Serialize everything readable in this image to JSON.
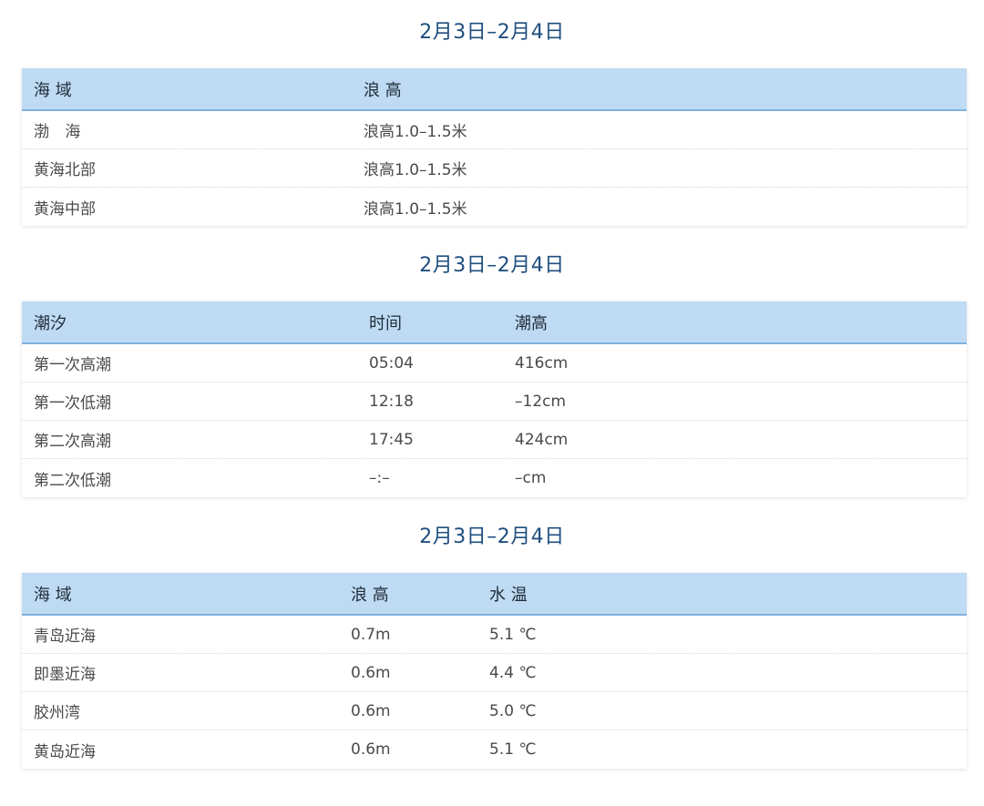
{
  "sections": [
    {
      "title": "2月3日–2月4日",
      "headers": [
        "海 域",
        "浪 高"
      ],
      "rows": [
        [
          "渤  海",
          "浪高1.0–1.5米"
        ],
        [
          "黄海北部",
          "浪高1.0–1.5米"
        ],
        [
          "黄海中部",
          "浪高1.0–1.5米"
        ]
      ]
    },
    {
      "title": "2月3日–2月4日",
      "headers": [
        "潮汐",
        "时间",
        "潮高"
      ],
      "rows": [
        [
          "第一次高潮",
          "05:04",
          "416cm"
        ],
        [
          "第一次低潮",
          "12:18",
          "–12cm"
        ],
        [
          "第二次高潮",
          "17:45",
          "424cm"
        ],
        [
          "第二次低潮",
          "–:–",
          "–cm"
        ]
      ]
    },
    {
      "title": "2月3日–2月4日",
      "headers": [
        "海 域",
        "浪 高",
        "水 温"
      ],
      "rows": [
        [
          "青岛近海",
          "0.7m",
          "5.1 ℃"
        ],
        [
          "即墨近海",
          "0.6m",
          "4.4 ℃"
        ],
        [
          "胶州湾",
          "0.6m",
          "5.0 ℃"
        ],
        [
          "黄岛近海",
          "0.6m",
          "5.1 ℃"
        ]
      ]
    }
  ],
  "colors": {
    "title": "#1f4e7e",
    "header_bg": "#bfdbf3",
    "header_border": "#7fb2de"
  }
}
